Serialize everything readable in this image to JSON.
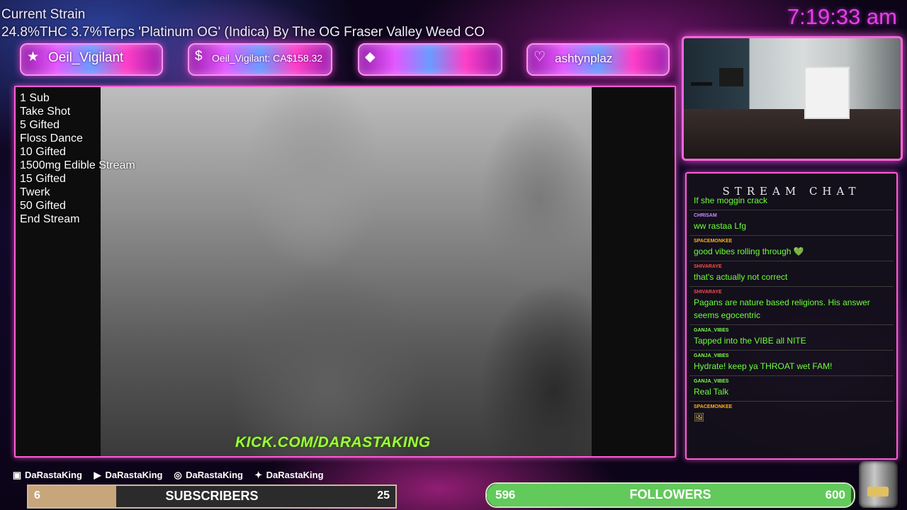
{
  "header": {
    "strain_title": "Current Strain",
    "strain_description": "24.8%THC 3.7%Terps 'Platinum OG' (Indica) By The OG Fraser Valley Weed CO",
    "clock": "7:19:33 am"
  },
  "alerts": [
    {
      "icon": "star-icon",
      "glyph": "★",
      "label": "Oeil_Vigilant"
    },
    {
      "icon": "dollar-icon",
      "glyph": "$",
      "label": "Oeil_Vigilant: CA$158.32"
    },
    {
      "icon": "diamond-icon",
      "glyph": "◆",
      "label": ""
    },
    {
      "icon": "heart-icon",
      "glyph": "♡",
      "label": "ashtynplaz"
    }
  ],
  "goals": [
    "1 Sub",
    "Take Shot",
    "5 Gifted",
    "Floss Dance",
    "10 Gifted",
    "1500mg Edible Stream",
    "15 Gifted",
    "Twerk",
    "50 Gifted",
    "End Stream"
  ],
  "video": {
    "watermark": "KICK.COM/DARASTAKING"
  },
  "chat": {
    "title": "STREAM CHAT",
    "messages": [
      {
        "user": "",
        "user_color": "#c88cff",
        "text": "If she moggin crack"
      },
      {
        "user": "CHRISAM",
        "user_color": "#c88cff",
        "text": "ww rastaa Lfg"
      },
      {
        "user": "SPACEMONKEE",
        "user_color": "#ffb020",
        "text": "good vibes rolling through 💚"
      },
      {
        "user": "SHIVARAYE",
        "user_color": "#ff4a4a",
        "text": "that's actually not correct"
      },
      {
        "user": "SHIVARAYE",
        "user_color": "#ff4a4a",
        "text": "Pagans are nature based religions. His answer seems egocentric"
      },
      {
        "user": "GANJA_VIBES",
        "user_color": "#7dff4a",
        "text": "Tapped into the VIBE all NITE"
      },
      {
        "user": "GANJA_VIBES",
        "user_color": "#7dff4a",
        "text": "Hydrate! keep ya THROAT wet FAM!"
      },
      {
        "user": "GANJA_VIBES",
        "user_color": "#7dff4a",
        "text": "Real Talk"
      },
      {
        "user": "SPACEMONKEE",
        "user_color": "#ffb020",
        "text": "🖼"
      }
    ]
  },
  "socials": [
    {
      "icon": "twitch-icon",
      "glyph": "▣",
      "handle": "DaRastaKing"
    },
    {
      "icon": "youtube-icon",
      "glyph": "▶",
      "handle": "DaRastaKing"
    },
    {
      "icon": "instagram-icon",
      "glyph": "◎",
      "handle": "DaRastaKing"
    },
    {
      "icon": "twitter-icon",
      "glyph": "✦",
      "handle": "DaRastaKing"
    }
  ],
  "subscribers": {
    "current": "6",
    "label": "SUBSCRIBERS",
    "goal": "25",
    "progress": 0.24
  },
  "followers": {
    "current": "596",
    "label": "FOLLOWERS",
    "goal": "600",
    "progress": 0.993
  },
  "colors": {
    "accent_pink": "#ff5bd6",
    "clock": "#e53fe9",
    "chat_text": "#6cff3a",
    "kick_green": "#9dff3d",
    "sub_fill": "#c7a67b",
    "follower_fill": "#62c95b"
  }
}
